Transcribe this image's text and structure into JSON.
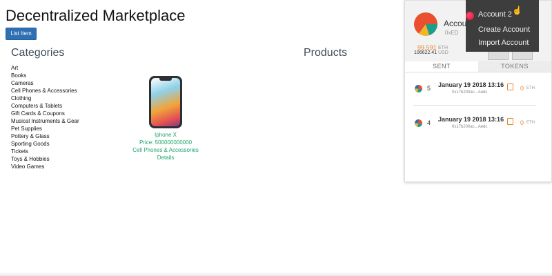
{
  "app": {
    "title": "Decentralized Marketplace",
    "list_item_label": "List Item"
  },
  "categories": {
    "heading": "Categories",
    "items": [
      "Art",
      "Books",
      "Cameras",
      "Cell Phones & Accessories",
      "Clothing",
      "Computers & Tablets",
      "Gift Cards & Coupons",
      "Musical Instruments & Gear",
      "Pet Supplies",
      "Pottery & Glass",
      "Sporting Goods",
      "Tickets",
      "Toys & Hobbies",
      "Video Games"
    ]
  },
  "products": {
    "heading": "Products",
    "items": [
      {
        "name": "Iphone X",
        "price_label": "Price: 500000000000",
        "category": "Cell Phones & Accessories",
        "details_label": "Details"
      }
    ]
  },
  "metamask": {
    "account_name": "Account 1",
    "account_address": "0xED",
    "eth_balance": "99.591",
    "eth_unit": "ETH",
    "usd_balance": "106622.41",
    "usd_unit": "USD",
    "menu_dots": "•••",
    "tabs": {
      "sent": "SENT",
      "tokens": "TOKENS"
    },
    "transactions": [
      {
        "nonce": "5",
        "date": "January 19 2018 13:16",
        "hash": "0x17b200ac...Aedc",
        "amount": "0",
        "unit": "ETH"
      },
      {
        "nonce": "4",
        "date": "January 19 2018 13:16",
        "hash": "0x17b200ac...Aedc",
        "amount": "0",
        "unit": "ETH"
      }
    ],
    "account_menu": {
      "items": [
        "Account 2",
        "Create Account",
        "Import Account"
      ]
    }
  },
  "colors": {
    "primary_button": "#2f6fb3",
    "product_text": "#1ba56b",
    "eth_orange": "#e8862f",
    "menu_bg": "#3d3d3d"
  }
}
